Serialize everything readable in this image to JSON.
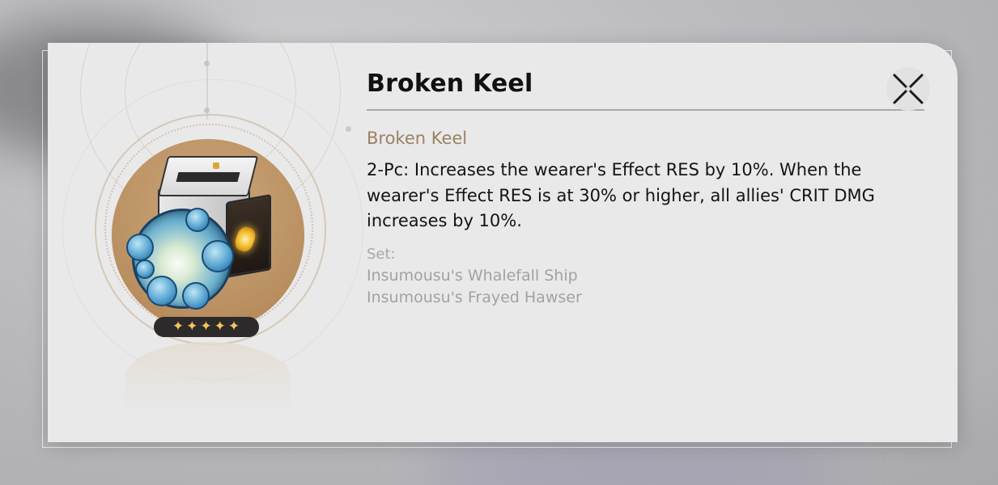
{
  "dialog": {
    "title": "Broken Keel",
    "close_icon": "close-icon",
    "item": {
      "name": "Broken Keel",
      "icon": "relic-icon",
      "rarity": 5,
      "rarity_stars": [
        "✦",
        "✦",
        "✦",
        "✦",
        "✦"
      ],
      "effect": "2-Pc: Increases the wearer's Effect RES by 10%. When the wearer's Effect RES is at 30% or higher, all allies' CRIT DMG increases by 10%.",
      "set_label": "Set:",
      "set_pieces": [
        "Insumousu's Whalefall Ship",
        "Insumousu's Frayed Hawser"
      ]
    }
  },
  "colors": {
    "panel_bg": "#e9e9ea",
    "set_name": "#9c8163",
    "medallion": "#b98f60",
    "star": "#f3c45a",
    "muted_text": "#a2a2a2"
  }
}
